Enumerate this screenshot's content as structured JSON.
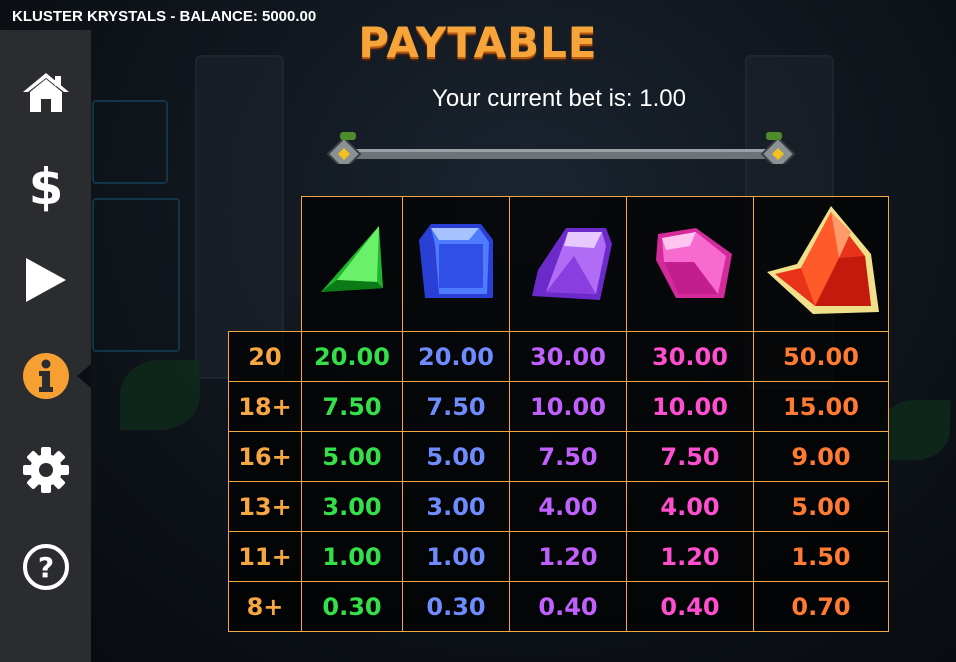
{
  "window": {
    "title": "KLUSTER KRYSTALS - BALANCE: 5000.00"
  },
  "sidebar": {
    "items": [
      {
        "icon": "home-icon"
      },
      {
        "icon": "dollar-icon"
      },
      {
        "icon": "play-icon"
      },
      {
        "icon": "info-icon",
        "active": true
      },
      {
        "icon": "gear-icon"
      },
      {
        "icon": "help-icon"
      }
    ]
  },
  "paytable": {
    "title": "PAYTABLE",
    "bet_text": "Your current bet is: 1.00",
    "symbols": [
      {
        "name": "green-crystal",
        "color": "#33e04a"
      },
      {
        "name": "blue-crystal",
        "color": "#6f8cff"
      },
      {
        "name": "purple-crystal",
        "color": "#c061ff"
      },
      {
        "name": "pink-crystal",
        "color": "#ff4fd0"
      },
      {
        "name": "red-crystal",
        "color": "#ff7a32"
      }
    ],
    "count_color": "#f6a642",
    "rows": [
      {
        "count": "20",
        "pays": [
          "20.00",
          "20.00",
          "30.00",
          "30.00",
          "50.00"
        ]
      },
      {
        "count": "18+",
        "pays": [
          "7.50",
          "7.50",
          "10.00",
          "10.00",
          "15.00"
        ]
      },
      {
        "count": "16+",
        "pays": [
          "5.00",
          "5.00",
          "7.50",
          "7.50",
          "9.00"
        ]
      },
      {
        "count": "13+",
        "pays": [
          "3.00",
          "3.00",
          "4.00",
          "4.00",
          "5.00"
        ]
      },
      {
        "count": "11+",
        "pays": [
          "1.00",
          "1.00",
          "1.20",
          "1.20",
          "1.50"
        ]
      },
      {
        "count": "8+",
        "pays": [
          "0.30",
          "0.30",
          "0.40",
          "0.40",
          "0.70"
        ]
      }
    ]
  }
}
